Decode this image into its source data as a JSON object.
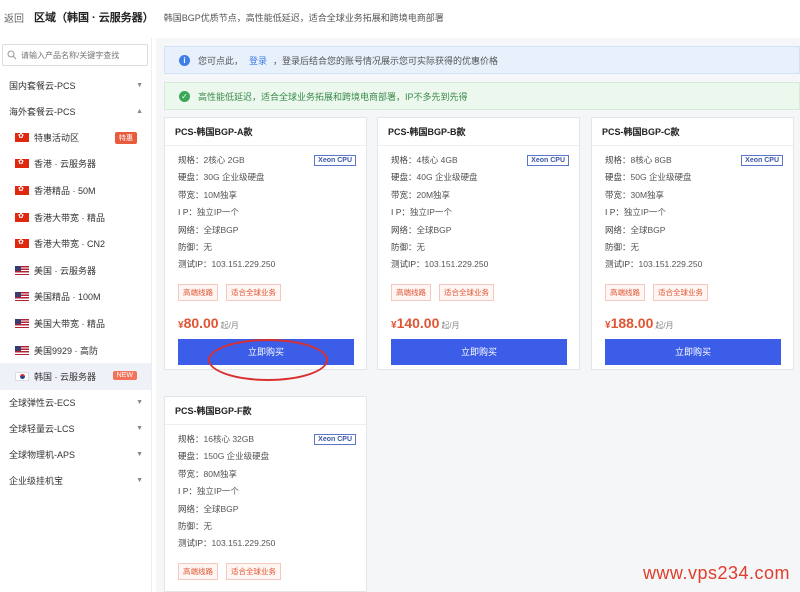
{
  "header": {
    "back_label": "返回",
    "title": "区域（韩国 · 云服务器）",
    "description": "韩国BGP优质节点，高性能低延迟，适合全球业务拓展和跨境电商部署"
  },
  "sidebar": {
    "search_placeholder": "请输入产品名称/关键字查找",
    "groups": [
      {
        "label": "国内套餐云-PCS"
      },
      {
        "label": "海外套餐云-PCS"
      },
      {
        "label": "全球弹性云-ECS"
      },
      {
        "label": "全球轻量云-LCS"
      },
      {
        "label": "全球物理机-APS"
      },
      {
        "label": "企业级挂机宝"
      }
    ],
    "items": [
      {
        "label": "特惠活动区",
        "flag": "hk",
        "badge": "特惠"
      },
      {
        "label": "香港 · 云服务器",
        "flag": "hk"
      },
      {
        "label": "香港精品 · 50M",
        "flag": "hk"
      },
      {
        "label": "香港大带宽 · 精品",
        "flag": "hk"
      },
      {
        "label": "香港大带宽 · CN2",
        "flag": "hk"
      },
      {
        "label": "美国 · 云服务器",
        "flag": "us"
      },
      {
        "label": "美国精品 · 100M",
        "flag": "us"
      },
      {
        "label": "美国大带宽 · 精品",
        "flag": "us"
      },
      {
        "label": "美国9929 · 高防",
        "flag": "us"
      },
      {
        "label": "韩国 · 云服务器",
        "flag": "kr",
        "badge": "NEW"
      }
    ]
  },
  "notices": {
    "info_pre": "您可点此，",
    "info_link": "登录",
    "info_post": "，登录后结合您的账号情况展示您可实际获得的优惠价格",
    "success": "高性能低延迟，适合全球业务拓展和跨境电商部署，IP不多先到先得"
  },
  "labels": {
    "spec": "规格：",
    "disk": "硬盘：",
    "bandwidth": "带宽：",
    "ip": "I P：",
    "network": "网络：",
    "defense": "防御：",
    "test_ip": "测试IP：",
    "cpu_badge": "Xeon CPU",
    "tag1": "高端线路",
    "tag2": "适合全球业务",
    "currency": "¥",
    "unit": "起/月",
    "buy": "立即购买"
  },
  "products": [
    {
      "name": "PCS-韩国BGP-A款",
      "spec": "2核心 2GB",
      "disk": "30G 企业级硬盘",
      "bandwidth": "10M独享",
      "ip": "独立IP一个",
      "network": "全球BGP",
      "defense": "无",
      "test_ip": "103.151.229.250",
      "price": "80.00"
    },
    {
      "name": "PCS-韩国BGP-B款",
      "spec": "4核心 4GB",
      "disk": "40G 企业级硬盘",
      "bandwidth": "20M独享",
      "ip": "独立IP一个",
      "network": "全球BGP",
      "defense": "无",
      "test_ip": "103.151.229.250",
      "price": "140.00"
    },
    {
      "name": "PCS-韩国BGP-C款",
      "spec": "8核心 8GB",
      "disk": "50G 企业级硬盘",
      "bandwidth": "30M独享",
      "ip": "独立IP一个",
      "network": "全球BGP",
      "defense": "无",
      "test_ip": "103.151.229.250",
      "price": "188.00"
    },
    {
      "name": "PCS-韩国BGP-F款",
      "spec": "16核心 32GB",
      "disk": "150G 企业级硬盘",
      "bandwidth": "80M独享",
      "ip": "独立IP一个",
      "network": "全球BGP",
      "defense": "无",
      "test_ip": "103.151.229.250",
      "price": ""
    }
  ],
  "watermark": "www.vps234.com",
  "colors": {
    "accent": "#3b5de8",
    "price": "#e05533",
    "annotation": "#d93030"
  }
}
